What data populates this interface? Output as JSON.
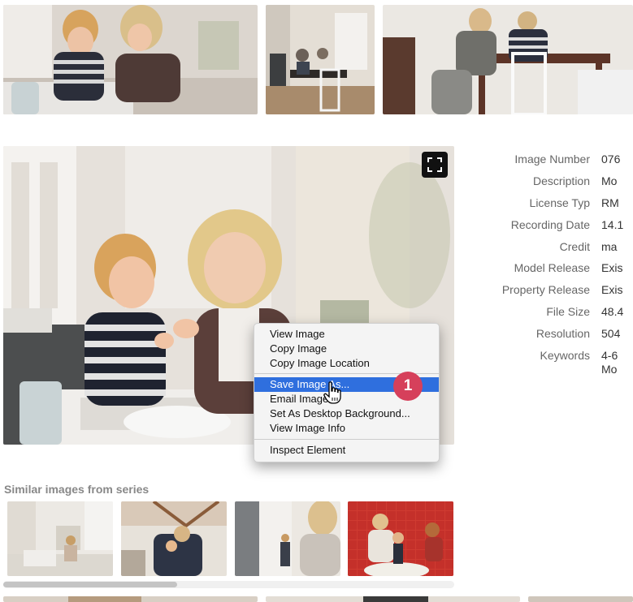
{
  "metadata": {
    "rows": [
      {
        "label": "Image Number",
        "value": "076"
      },
      {
        "label": "Description",
        "value": "Mo"
      },
      {
        "label": "License Typ",
        "value": "RM"
      },
      {
        "label": "Recording Date",
        "value": "14.1"
      },
      {
        "label": "Credit",
        "value": "ma"
      },
      {
        "label": "Model Release",
        "value": "Exis"
      },
      {
        "label": "Property Release",
        "value": "Exis"
      },
      {
        "label": "File Size",
        "value": "48.4"
      },
      {
        "label": "Resolution",
        "value": "504"
      },
      {
        "label": "Keywords",
        "value": "4-6",
        "value2": "Mo"
      }
    ]
  },
  "context_menu": {
    "items": [
      "View Image",
      "Copy Image",
      "Copy Image Location",
      "Save Image As...",
      "Email Image...",
      "Set As Desktop Background...",
      "View Image Info",
      "Inspect Element"
    ],
    "highlighted": "Save Image As..."
  },
  "badge": {
    "number": "1",
    "color": "#d6405b"
  },
  "similar": {
    "title": "Similar images from series"
  },
  "icons": {
    "fullscreen": "fullscreen-icon",
    "cursor": "hand-pointer-icon"
  }
}
